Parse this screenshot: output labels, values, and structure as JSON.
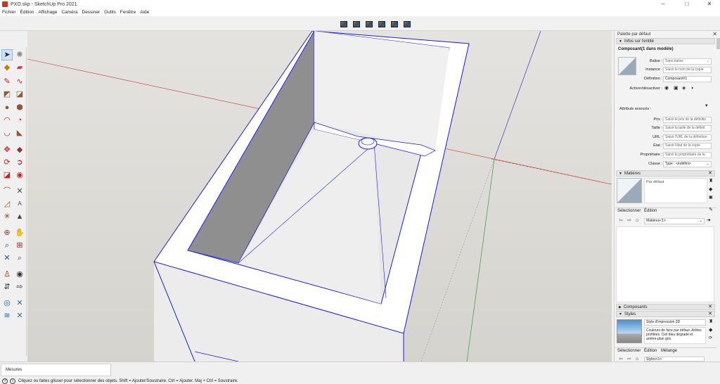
{
  "window": {
    "title": "PXO.skp - SketchUp Pro 2021",
    "minimize": "–",
    "maximize": "□",
    "close": "✕"
  },
  "menu": [
    "Fichier",
    "Édition",
    "Affichage",
    "Caméra",
    "Dessiner",
    "Outils",
    "Fenêtre",
    "Aide"
  ],
  "tray": {
    "title": "Palette par défaut",
    "close": "✕",
    "entity_info": {
      "header": "Infos sur l'entité",
      "heading": "Composant(1 dans modèle)",
      "balise_label": "Balise :",
      "balise_value": "Sans balise",
      "instance_label": "Instance :",
      "instance_placeholder": "Saisir le nom de la copie",
      "definition_label": "Définition :",
      "definition_value": "Composant#1",
      "activer_label": "Activer/désactiver :",
      "attributs_label": "Attributs avancés :",
      "prix_label": "Prix :",
      "prix_placeholder": "Saisir le prix de la définitio",
      "taille_label": "Taille :",
      "taille_placeholder": "Saisir la taille de la définit",
      "url_label": "URL :",
      "url_placeholder": "Saisir l'URL de la définition",
      "etat_label": "État :",
      "etat_placeholder": "Saisir l'état de la copie",
      "proprietaire_label": "Propriétaire :",
      "proprietaire_placeholder": "Saisir le propriétaire de la",
      "classe_label": "Classe :",
      "classe_value": "Type : <indéfini>"
    },
    "materials": {
      "header": "Matières",
      "swatch_name": "Par défaut",
      "tab_select": "Sélectionner",
      "tab_edit": "Édition",
      "dropdown": "Matières<1>"
    },
    "components": {
      "header": "Composants"
    },
    "styles": {
      "header": "Styles",
      "style_name": "Style d'impression 3D",
      "description": "Couleurs de face par défaut. Arêtes profilées. Ciel bleu dégradé et arrière-plan gris",
      "tab_select": "Sélectionner",
      "tab_edit": "Édition",
      "tab_mix": "Mélange",
      "dropdown": "Styles<1>"
    }
  },
  "status": {
    "mesures_label": "Mesures",
    "info_icon": "i",
    "text": "Cliquez ou faites glisser pour sélectionner des objets. Shift = Ajouter/Soustraire. Ctrl = Ajouter. Maj + Ctrl = Soustraire."
  },
  "icons": {
    "select-arrow": "➤",
    "eraser": "▰",
    "pencil": "✎",
    "arc": "◠",
    "circle": "◯",
    "move": "✥",
    "rotate": "⟳",
    "tape": "⌒",
    "text": "A",
    "orbit": "⊕",
    "zoom": "⌕",
    "walk": "⇵",
    "eye": "👁"
  },
  "colors": {
    "edge_selected": "#1a1aff",
    "viewport_bg": "#dcdad5",
    "axis_red": "#c0392b",
    "axis_green": "#3a9a3a",
    "axis_blue": "#3a3ab8"
  }
}
